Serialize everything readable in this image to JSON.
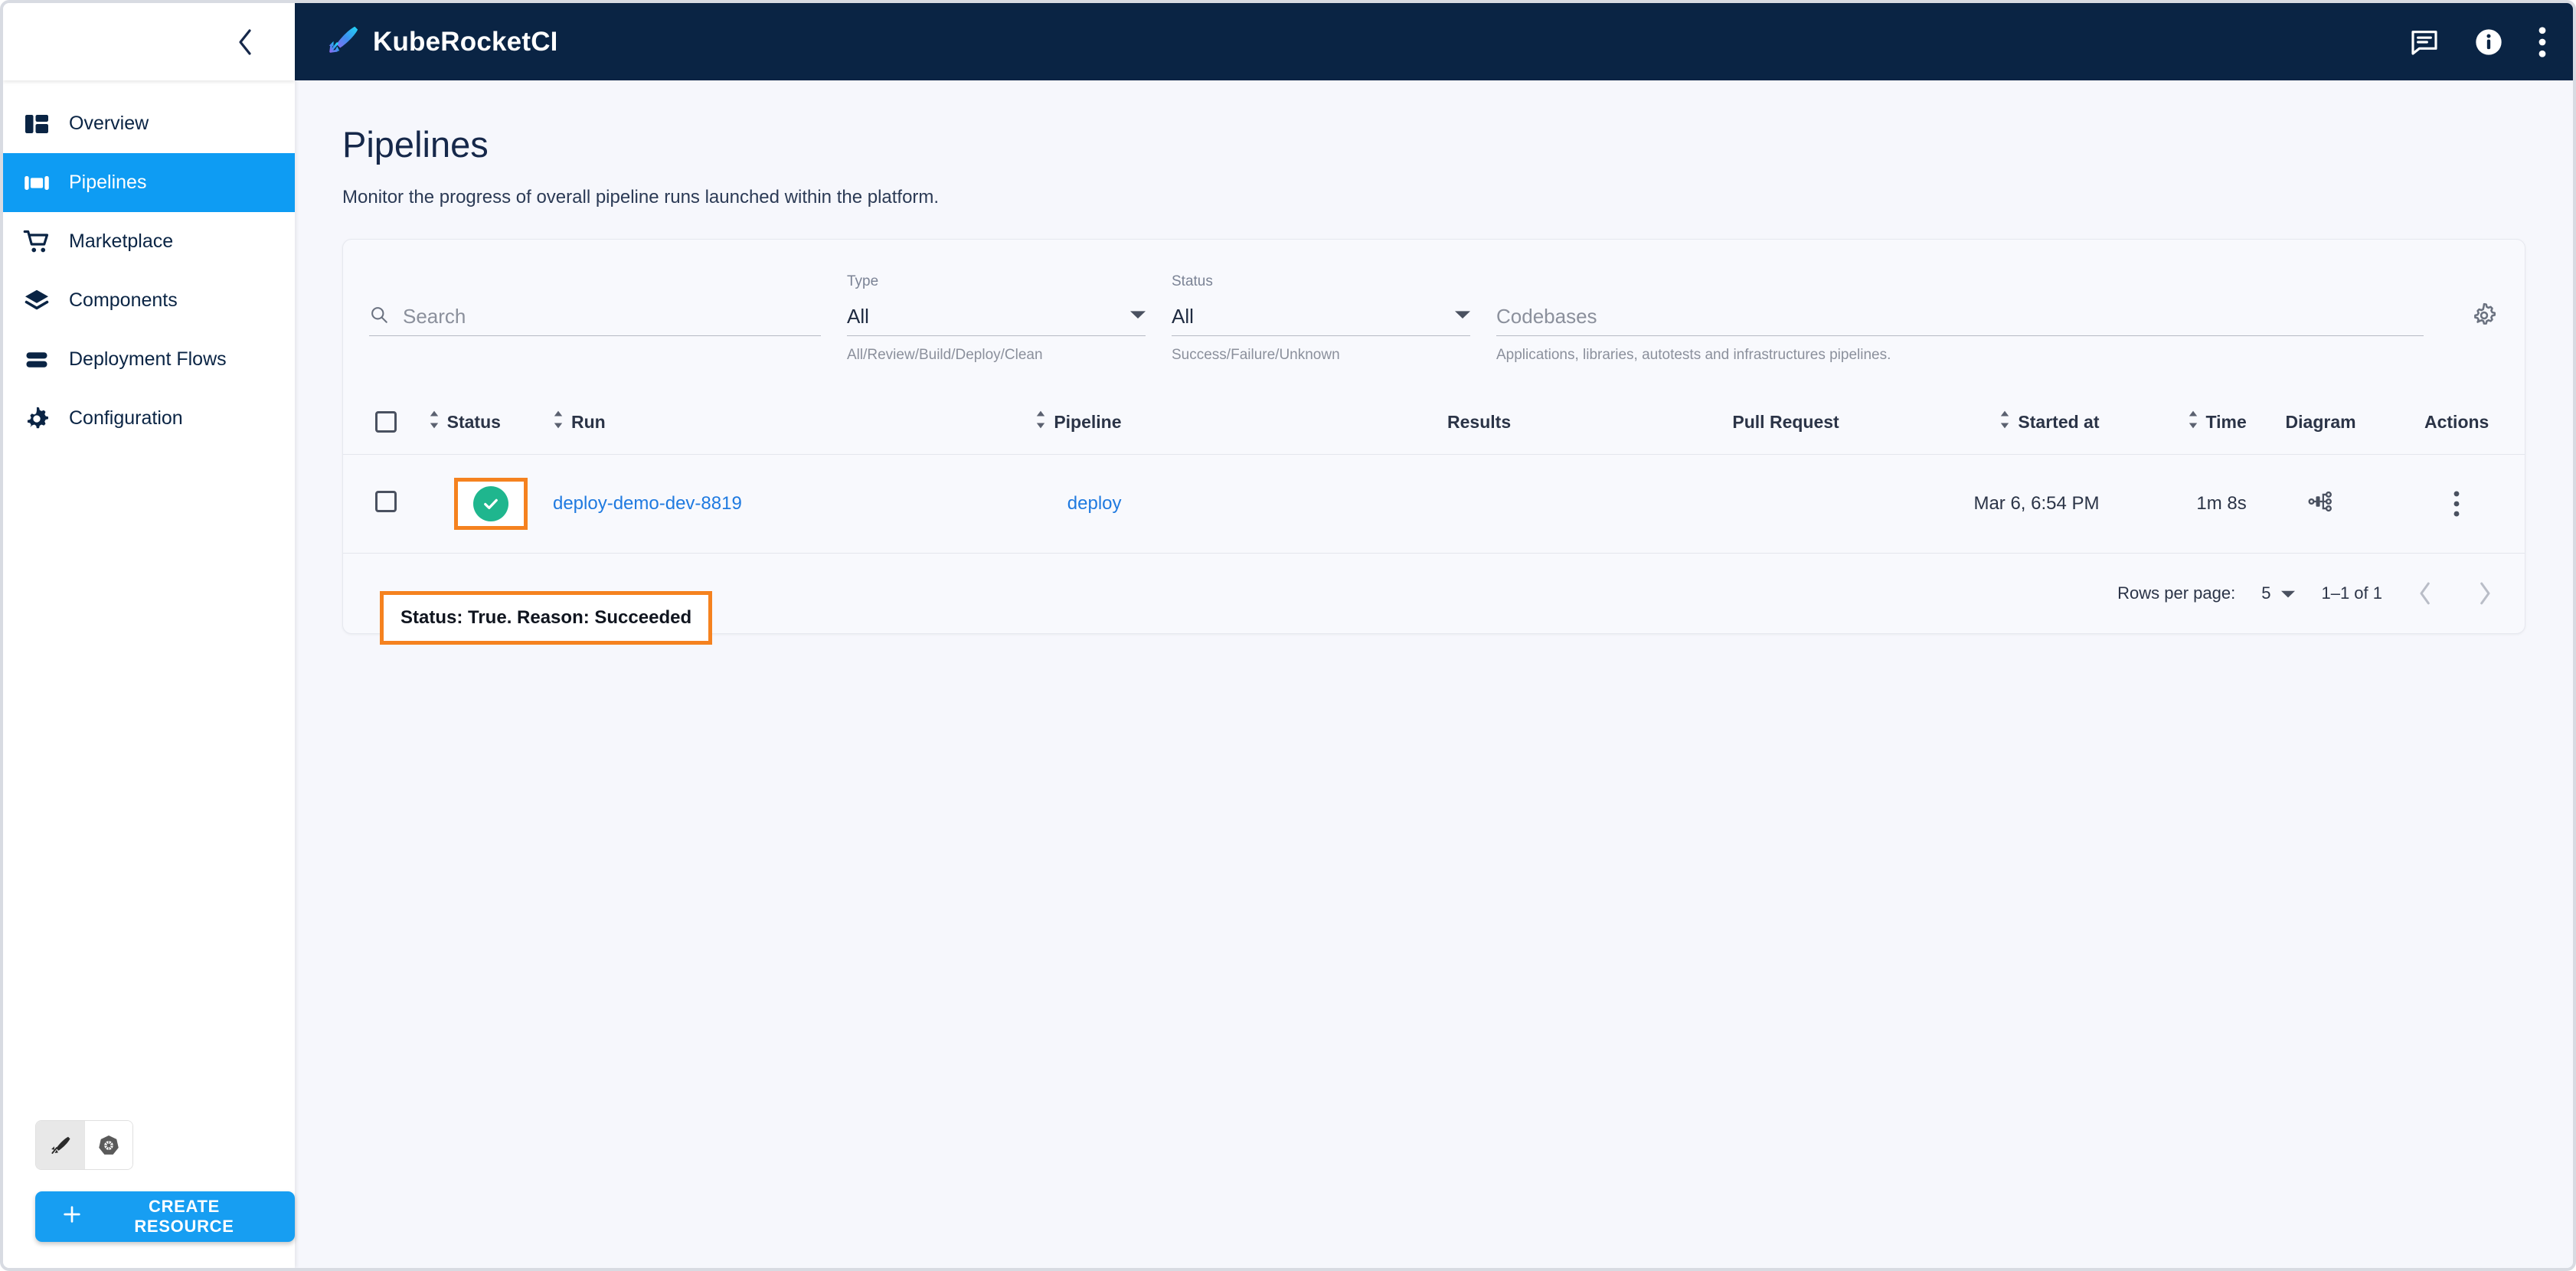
{
  "app": {
    "brand_title": "KubeRocketCI",
    "logo_icon": "rocket-feather-icon",
    "collapse_icon": "chevron-left-icon",
    "header_actions": [
      {
        "name": "feedback-icon",
        "label": "Feedback"
      },
      {
        "name": "info-icon",
        "label": "Information"
      },
      {
        "name": "more-vertical-icon",
        "label": "More"
      }
    ]
  },
  "sidebar": {
    "items": [
      {
        "label": "Overview",
        "icon": "dashboard-icon",
        "active": false
      },
      {
        "label": "Pipelines",
        "icon": "pipelines-icon",
        "active": true
      },
      {
        "label": "Marketplace",
        "icon": "cart-icon",
        "active": false
      },
      {
        "label": "Components",
        "icon": "layers-icon",
        "active": false
      },
      {
        "label": "Deployment Flows",
        "icon": "flows-icon",
        "active": false
      },
      {
        "label": "Configuration",
        "icon": "gear-icon",
        "active": false
      }
    ],
    "view_toggle": [
      {
        "name": "krci-view-icon",
        "selected": true
      },
      {
        "name": "kubernetes-view-icon",
        "selected": false
      }
    ],
    "create_button": {
      "label": "CREATE RESOURCE",
      "icon": "plus-icon",
      "color": "#179ef2"
    }
  },
  "page": {
    "title": "Pipelines",
    "subtitle": "Monitor the progress of overall pipeline runs launched within the platform."
  },
  "filters": {
    "search": {
      "label": "",
      "placeholder": "Search",
      "value": "",
      "icon": "search-icon"
    },
    "type": {
      "label": "Type",
      "value": "All",
      "help": "All/Review/Build/Deploy/Clean",
      "options": [
        "All",
        "Review",
        "Build",
        "Deploy",
        "Clean"
      ]
    },
    "status": {
      "label": "Status",
      "value": "All",
      "help": "Success/Failure/Unknown",
      "options": [
        "All",
        "Success",
        "Failure",
        "Unknown"
      ]
    },
    "codebases": {
      "label": "",
      "placeholder": "Codebases",
      "value": "",
      "help": "Applications, libraries, autotests and infrastructures pipelines."
    },
    "settings_icon": "gear-icon"
  },
  "table": {
    "columns": [
      {
        "key": "select",
        "label": "",
        "sortable": false
      },
      {
        "key": "status",
        "label": "Status",
        "sortable": true
      },
      {
        "key": "run",
        "label": "Run",
        "sortable": true
      },
      {
        "key": "pipeline",
        "label": "Pipeline",
        "sortable": true
      },
      {
        "key": "results",
        "label": "Results",
        "sortable": false
      },
      {
        "key": "pull_request",
        "label": "Pull Request",
        "sortable": false
      },
      {
        "key": "started_at",
        "label": "Started at",
        "sortable": true
      },
      {
        "key": "time",
        "label": "Time",
        "sortable": true
      },
      {
        "key": "diagram",
        "label": "Diagram",
        "sortable": false
      },
      {
        "key": "actions",
        "label": "Actions",
        "sortable": false
      }
    ],
    "rows": [
      {
        "selected": false,
        "status": {
          "state": "success",
          "icon": "check-circle-icon",
          "color": "#1fb68e",
          "highlighted": true
        },
        "run": "deploy-demo-dev-8819",
        "pipeline": "deploy",
        "results": "",
        "pull_request": "",
        "started_at": "Mar 6, 6:54 PM",
        "time": "1m 8s",
        "diagram_icon": "hierarchy-icon",
        "actions_icon": "more-vertical-icon"
      }
    ]
  },
  "tooltip": {
    "text": "Status: True. Reason: Succeeded",
    "border_color": "#f5821f"
  },
  "pagination": {
    "rows_per_page_label": "Rows per page:",
    "rows_per_page_value": "5",
    "range_label": "1–1 of 1",
    "prev_icon": "chevron-left-icon",
    "next_icon": "chevron-right-icon"
  }
}
